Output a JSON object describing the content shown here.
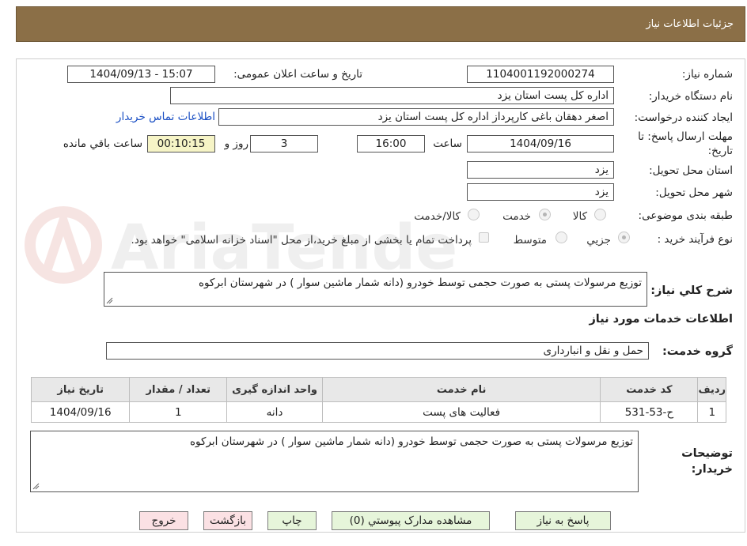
{
  "header": {
    "title": "جزئیات اطلاعات نیاز"
  },
  "form": {
    "need_number_label": "شماره نیاز:",
    "need_number": "1104001192000274",
    "announce_label": "تاریخ و ساعت اعلان عمومی:",
    "announce_value": "1404/09/13 - 15:07",
    "buyer_org_label": "نام دستگاه خریدار:",
    "buyer_org": "اداره کل پست استان یزد",
    "requester_label": "ایجاد کننده درخواست:",
    "requester": "اصغر دهقان باغی کارپرداز اداره کل پست استان یزد",
    "contact_link": "اطلاعات تماس خریدار",
    "deadline_label_1": "مهلت ارسال پاسخ: تا",
    "deadline_label_2": "تاریخ:",
    "deadline_date": "1404/09/16",
    "time_label": "ساعت",
    "deadline_time": "16:00",
    "days": "3",
    "days_label": "روز و",
    "remaining": "00:10:15",
    "remaining_label": "ساعت باقي مانده",
    "province_label": "استان محل تحویل:",
    "province": "یزد",
    "city_label": "شهر محل تحویل:",
    "city": "یزد",
    "category_label": "طبقه بندی موضوعی:",
    "category_options": [
      "کالا",
      "خدمت",
      "کالا/خدمت"
    ],
    "category_selected": "خدمت",
    "process_label": "نوع فرآیند خرید :",
    "process_options": [
      "جزيي",
      "متوسط"
    ],
    "process_selected": "جزيي",
    "payment_note": "پرداخت تمام یا بخشی از مبلغ خرید،از محل \"اسناد خزانه اسلامی\" خواهد بود.",
    "summary_label": "شرح کلي نیاز:",
    "summary": "توزیع مرسولات پستی به صورت حجمی توسط خودرو (دانه شمار ماشین سوار ) در شهرستان ابرکوه",
    "services_heading": "اطلاعات خدمات مورد نیاز",
    "service_group_label": "گروه خدمت:",
    "service_group": "حمل و نقل و انبارداری",
    "buyer_notes_label_1": "توضیحات",
    "buyer_notes_label_2": "خریدار:",
    "buyer_notes": "توزیع مرسولات پستی به صورت حجمی توسط خودرو (دانه شمار ماشین سوار ) در شهرستان ابرکوه"
  },
  "table": {
    "headers": [
      "ردیف",
      "کد خدمت",
      "نام خدمت",
      "واحد اندازه گیری",
      "تعداد / مقدار",
      "تاریخ نیاز"
    ],
    "rows": [
      [
        "1",
        "ح-53-531",
        "فعالیت های پست",
        "دانه",
        "1",
        "1404/09/16"
      ]
    ]
  },
  "buttons": {
    "reply": "پاسخ به نیاز",
    "attachments": "مشاهده مدارک پیوستي (0)",
    "print": "چاپ",
    "back": "بازگشت",
    "exit": "خروج"
  },
  "watermark": {
    "text": "AriaTender.neT"
  },
  "colors": {
    "header_bg": "#8b6f47",
    "link": "#1a4fc4",
    "highlight": "#f6f4c6",
    "btn_green": "#e6f5da",
    "btn_pink": "#fbe1e4"
  }
}
